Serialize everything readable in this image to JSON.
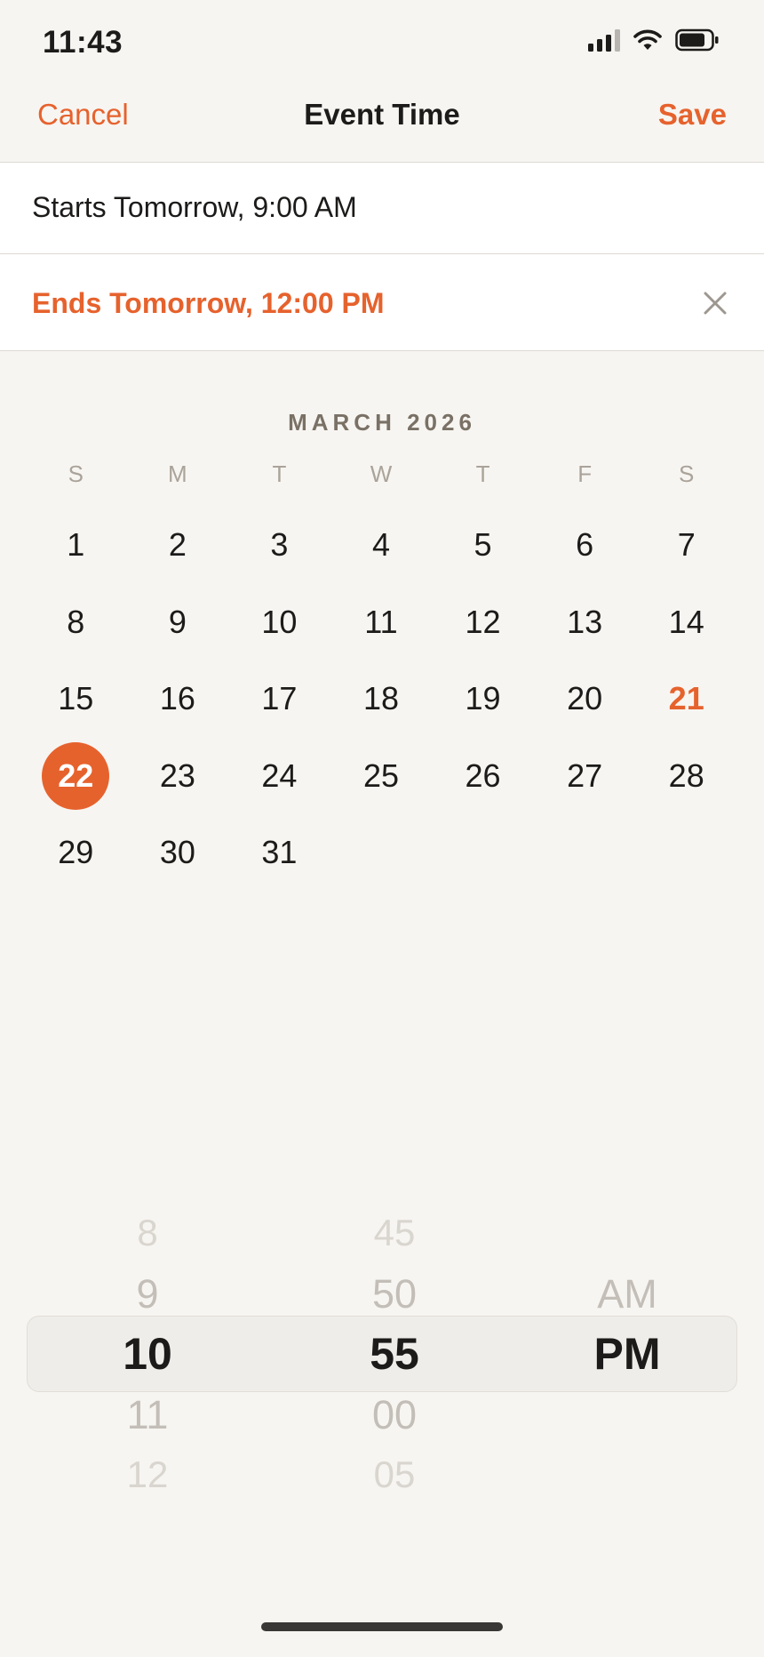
{
  "status_bar": {
    "time": "11:43",
    "icons": [
      "signal-icon",
      "wifi-icon",
      "battery-icon"
    ]
  },
  "nav": {
    "cancel_label": "Cancel",
    "title": "Event Time",
    "save_label": "Save"
  },
  "event": {
    "start_label": "Starts Tomorrow, 9:00 AM",
    "end_label": "Ends Tomorrow, 12:00 PM",
    "clear_icon": "close-icon"
  },
  "calendar": {
    "month_label": "MARCH 2026",
    "weekdays": [
      "S",
      "M",
      "T",
      "W",
      "T",
      "F",
      "S"
    ],
    "days": [
      "1",
      "2",
      "3",
      "4",
      "5",
      "6",
      "7",
      "8",
      "9",
      "10",
      "11",
      "12",
      "13",
      "14",
      "15",
      "16",
      "17",
      "18",
      "19",
      "20",
      "21",
      "22",
      "23",
      "24",
      "25",
      "26",
      "27",
      "28",
      "29",
      "30",
      "31"
    ],
    "today": "21",
    "selected": "22"
  },
  "picker": {
    "hour": {
      "above": [
        "8",
        "9"
      ],
      "selected": "10",
      "below": [
        "11",
        "12"
      ]
    },
    "minute": {
      "above": [
        "45",
        "50"
      ],
      "selected": "55",
      "below": [
        "00",
        "05"
      ]
    },
    "period": {
      "above": [
        "AM"
      ],
      "selected": "PM",
      "below": []
    }
  },
  "colors": {
    "accent": "#e6622d",
    "background": "#f7f5f1",
    "text": "#1c1b1a",
    "muted": "#aaa39a"
  }
}
